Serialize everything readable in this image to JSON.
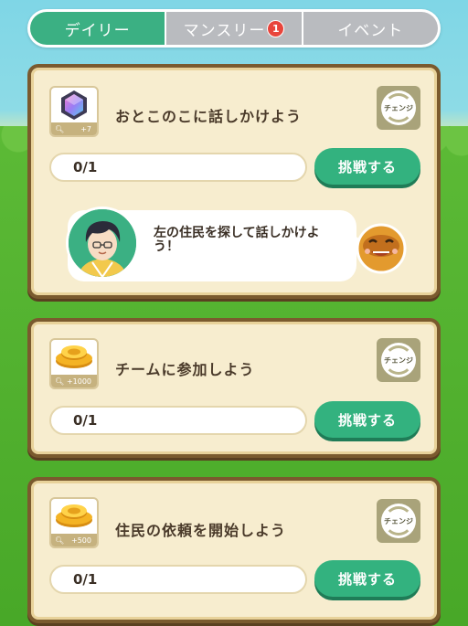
{
  "tabs": [
    {
      "label": "デイリー"
    },
    {
      "label": "マンスリー",
      "badge": "1"
    },
    {
      "label": "イベント"
    }
  ],
  "missions": [
    {
      "title": "おとこのこに話しかけよう",
      "reward_amount": "+7",
      "reward_icon": "gem-icon",
      "progress": "0/1",
      "button": "挑戦する",
      "change_label": "チェンジ"
    },
    {
      "title": "チームに参加しよう",
      "reward_amount": "+1000",
      "reward_icon": "coin-icon",
      "progress": "0/1",
      "button": "挑戦する",
      "change_label": "チェンジ"
    },
    {
      "title": "住民の依頼を開始しよう",
      "reward_amount": "+500",
      "reward_icon": "coin-icon",
      "progress": "0/1",
      "button": "挑戦する",
      "change_label": "チェンジ"
    }
  ],
  "dialogue": {
    "text": "左の住民を探して話しかけよう！"
  },
  "colors": {
    "accent": "#3bb083",
    "badge": "#e8453c",
    "card_border": "#7a5a2e",
    "card_bg": "#f7edcf"
  }
}
